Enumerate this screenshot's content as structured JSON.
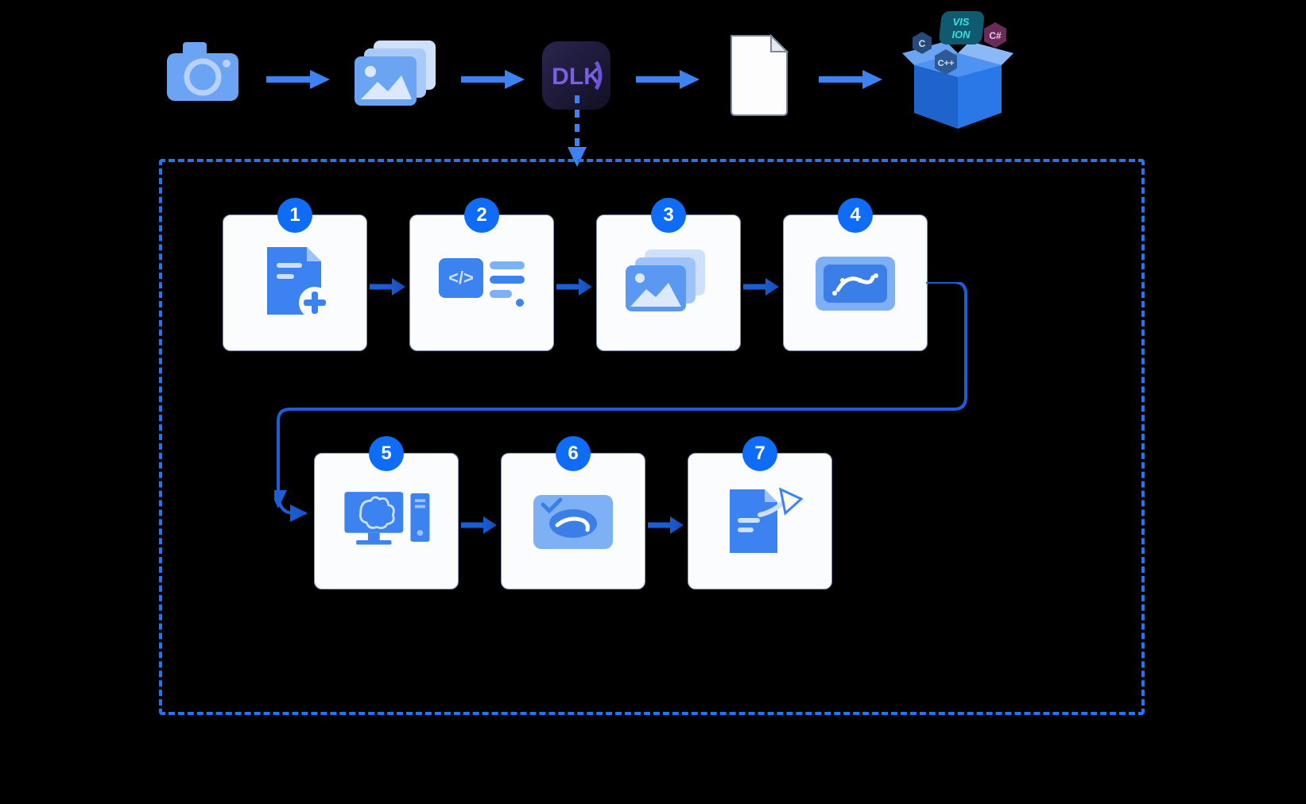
{
  "colors": {
    "blue_primary": "#2674f0",
    "blue_light": "#7eb0f5",
    "blue_lighter": "#a9c9f8",
    "badge_bg": "#0f6cf7",
    "arrow_blue": "#3c83f1",
    "card_bg": "#fbfcfe"
  },
  "pipeline": {
    "nodes": [
      {
        "id": "camera",
        "icon": "camera-icon",
        "label": ""
      },
      {
        "id": "images",
        "icon": "image-stack-icon",
        "label": ""
      },
      {
        "id": "dlk",
        "icon": "dlk-app-icon",
        "label": "DLK"
      },
      {
        "id": "document",
        "icon": "document-icon",
        "label": ""
      },
      {
        "id": "toolbox",
        "icon": "vision-box-icon",
        "label": "VISION",
        "tags": [
          "C",
          "C++",
          "C#"
        ]
      }
    ]
  },
  "steps": [
    {
      "num": "1",
      "icon": "new-file-plus-icon",
      "desc": ""
    },
    {
      "num": "2",
      "icon": "code-settings-icon",
      "desc": ""
    },
    {
      "num": "3",
      "icon": "image-stack-icon",
      "desc": ""
    },
    {
      "num": "4",
      "icon": "annotate-image-icon",
      "desc": ""
    },
    {
      "num": "5",
      "icon": "train-computer-icon",
      "desc": ""
    },
    {
      "num": "6",
      "icon": "validate-image-icon",
      "desc": ""
    },
    {
      "num": "7",
      "icon": "export-file-icon",
      "desc": ""
    }
  ]
}
